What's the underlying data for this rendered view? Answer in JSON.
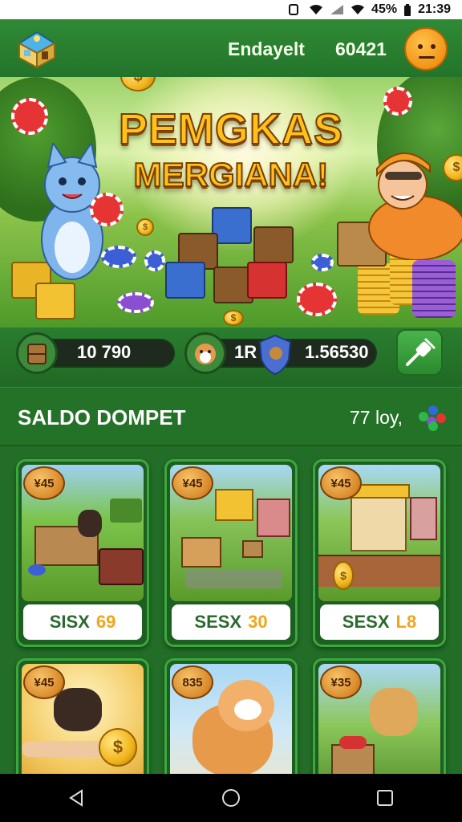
{
  "status_bar": {
    "battery": "45%",
    "time": "21:39"
  },
  "header": {
    "username": "Endayelt",
    "coins": "60421"
  },
  "banner": {
    "title_line1": "PEMGKAS",
    "title_line2": "MERGIANA!"
  },
  "resources": {
    "left_value": "10 790",
    "mid_label": "1R",
    "right_value": "1.56530"
  },
  "wallet": {
    "title": "SALDO DOMPET",
    "count": "77 loy,"
  },
  "cards": [
    {
      "badge": "¥45",
      "name": "SISX",
      "price": "69"
    },
    {
      "badge": "¥45",
      "name": "SESX",
      "price": "30"
    },
    {
      "badge": "¥45",
      "name": "SESX",
      "price": "L8"
    },
    {
      "badge": "¥45",
      "name": "",
      "price": ""
    },
    {
      "badge": "835",
      "name": "",
      "price": ""
    },
    {
      "badge": "¥35",
      "name": "",
      "price": ""
    }
  ],
  "colors": {
    "primary_green": "#247128",
    "accent_gold": "#f2a51a",
    "avatar_orange": "#f29417"
  },
  "icons": {
    "logo": "house-logo-icon",
    "avatar": "emoji-face-icon",
    "settings": "plug-icon",
    "nav_back": "back-triangle-icon",
    "nav_home": "home-circle-icon",
    "nav_recent": "recent-square-icon"
  }
}
